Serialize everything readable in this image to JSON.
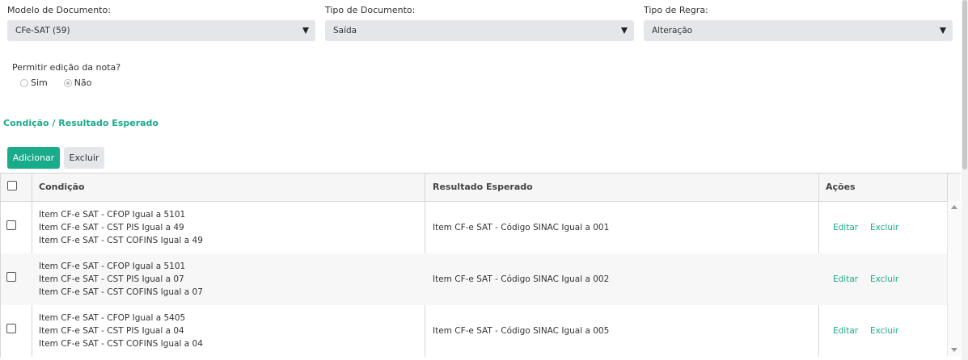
{
  "filters": [
    {
      "label": "Modelo de Documento:",
      "value": "CFe-SAT (59)"
    },
    {
      "label": "Tipo de Documento:",
      "value": "Saída"
    },
    {
      "label": "Tipo de Regra:",
      "value": "Alteração"
    }
  ],
  "edit_permission": {
    "question": "Permitir edição da nota?",
    "options": [
      "Sim",
      "Não"
    ],
    "selected": "Não"
  },
  "section_title": "Condição / Resultado Esperado",
  "buttons": {
    "add": "Adicionar",
    "delete": "Excluir"
  },
  "table": {
    "headers": {
      "condition": "Condição",
      "result": "Resultado Esperado",
      "actions": "Ações"
    },
    "rows": [
      {
        "conditions": [
          "Item CF-e SAT - CFOP Igual a 5101",
          "Item CF-e SAT - CST PIS Igual a 49",
          "Item CF-e SAT - CST COFINS Igual a 49"
        ],
        "result": "Item CF-e SAT - Código SINAC Igual a 001",
        "edit": "Editar",
        "delete": "Excluir"
      },
      {
        "conditions": [
          "Item CF-e SAT - CFOP Igual a 5101",
          "Item CF-e SAT - CST PIS Igual a 07",
          "Item CF-e SAT - CST COFINS Igual a 07"
        ],
        "result": "Item CF-e SAT - Código SINAC Igual a 002",
        "edit": "Editar",
        "delete": "Excluir"
      },
      {
        "conditions": [
          "Item CF-e SAT - CFOP Igual a 5405",
          "Item CF-e SAT - CST PIS Igual a 04",
          "Item CF-e SAT - CST COFINS Igual a 04"
        ],
        "result": "Item CF-e SAT - Código SINAC Igual a 005",
        "edit": "Editar",
        "delete": "Excluir"
      }
    ]
  },
  "colors": {
    "accent": "#1aab8a",
    "select_bg": "#e4e6ea"
  },
  "icons": [
    "caret-down-icon",
    "checkbox-icon",
    "radio-icon",
    "scroll-up-arrow-icon",
    "scroll-down-arrow-icon"
  ]
}
